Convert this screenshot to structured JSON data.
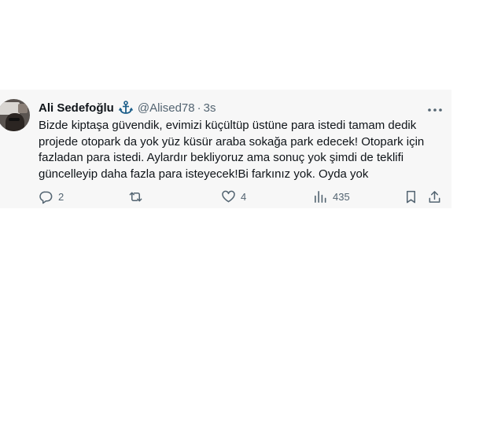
{
  "tweet": {
    "author_name": "Ali Sedefoğlu",
    "handle": "@Alised78",
    "separator": "·",
    "time": "3s",
    "text": "Bizde kiptaşa güvendik, evimizi küçültüp üstüne para istedi tamam dedik projede otopark da yok yüz küsür araba sokağa park edecek! Otopark için fazladan para istedi. Aylardır bekliyoruz ama sonuç yok şimdi de teklifi güncelleyip daha fazla para isteyecek!Bi farkınız yok. Oyda yok",
    "badge_icon": "anchor-icon",
    "actions": {
      "replies": "2",
      "retweets": "",
      "likes": "4",
      "views": "435"
    }
  },
  "colors": {
    "background": "#f7f7f7",
    "text": "#0f1419",
    "secondary_text": "#536471",
    "badge": "#1d5f8a"
  }
}
